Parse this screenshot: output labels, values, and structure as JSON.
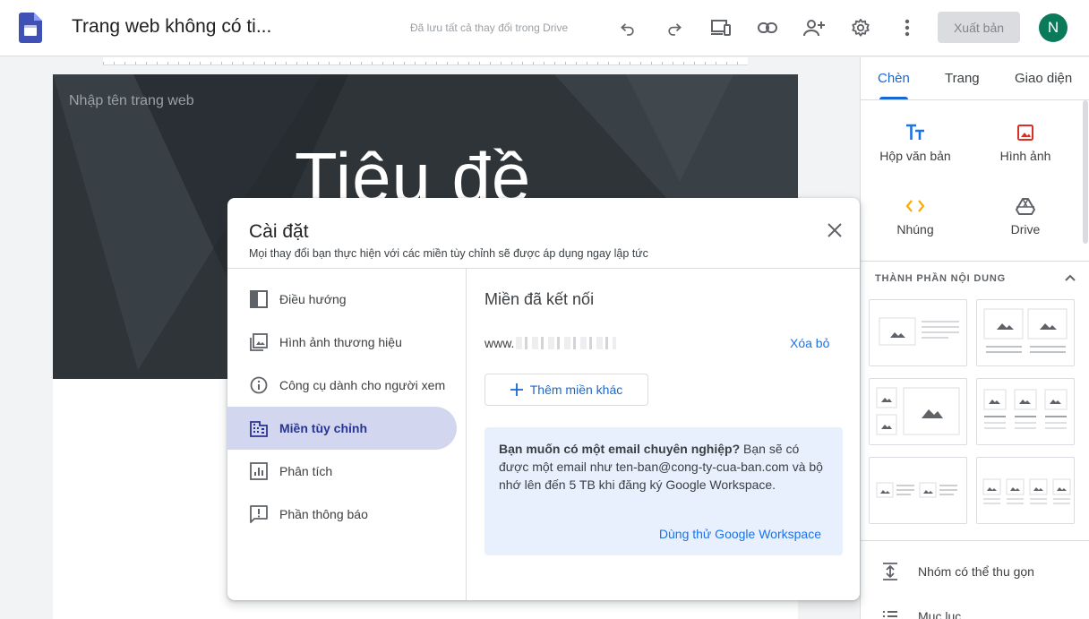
{
  "app": {
    "icon": "google-sites-logo",
    "title": "Trang web không có ti...",
    "save_status": "Đã lưu tất cả thay đổi trong Drive",
    "publish_label": "Xuất bản",
    "avatar_initial": "N",
    "avatar_color": "#0b7a5b",
    "toolbar_icons": [
      "undo-icon",
      "redo-icon",
      "preview-devices-icon",
      "link-icon",
      "share-icon",
      "settings-icon",
      "more-vert-icon"
    ]
  },
  "canvas": {
    "site_name_placeholder": "Nhập tên trang web",
    "hero_title": "Tiêu đề"
  },
  "panel": {
    "tabs": [
      {
        "label": "Chèn",
        "active": true
      },
      {
        "label": "Trang",
        "active": false
      },
      {
        "label": "Giao diện",
        "active": false
      }
    ],
    "insert_items": [
      {
        "label": "Hộp văn bản",
        "icon": "text-box-icon"
      },
      {
        "label": "Hình ảnh",
        "icon": "image-icon"
      },
      {
        "label": "Nhúng",
        "icon": "embed-icon"
      },
      {
        "label": "Drive",
        "icon": "drive-icon"
      }
    ],
    "content_section_title": "THÀNH PHẦN NỘI DUNG",
    "list_items": [
      {
        "label": "Nhóm có thể thu gọn",
        "icon": "collapsible-icon"
      },
      {
        "label": "Mục lục",
        "icon": "toc-icon"
      }
    ]
  },
  "dialog": {
    "title": "Cài đặt",
    "subtitle": "Mọi thay đổi bạn thực hiện với các miền tùy chỉnh sẽ được áp dụng ngay lập tức",
    "nav": [
      {
        "label": "Điều hướng",
        "icon": "navigation-icon",
        "active": false
      },
      {
        "label": "Hình ảnh thương hiệu",
        "icon": "brand-images-icon",
        "active": false
      },
      {
        "label": "Công cụ dành cho người xem",
        "icon": "info-icon",
        "active": false
      },
      {
        "label": "Miền tùy chỉnh",
        "icon": "domain-icon",
        "active": true
      },
      {
        "label": "Phân tích",
        "icon": "analytics-icon",
        "active": false
      },
      {
        "label": "Phần thông báo",
        "icon": "announcement-icon",
        "active": false
      }
    ],
    "content": {
      "heading": "Miền đã kết nối",
      "domain_prefix": "www.",
      "remove_label": "Xóa bỏ",
      "add_domain_label": "Thêm miền khác",
      "promo_bold": "Bạn muốn có một email chuyên nghiệp?",
      "promo_text": " Bạn sẽ có được một email như ten-ban@cong-ty-cua-ban.com và bộ nhớ lên đến 5 TB khi đăng ký Google Workspace.",
      "promo_link": "Dùng thử Google Workspace"
    }
  },
  "colors": {
    "accent": "#1967d2",
    "active_nav_bg": "#d2d6ee",
    "promo_bg": "#e8f0fe"
  }
}
